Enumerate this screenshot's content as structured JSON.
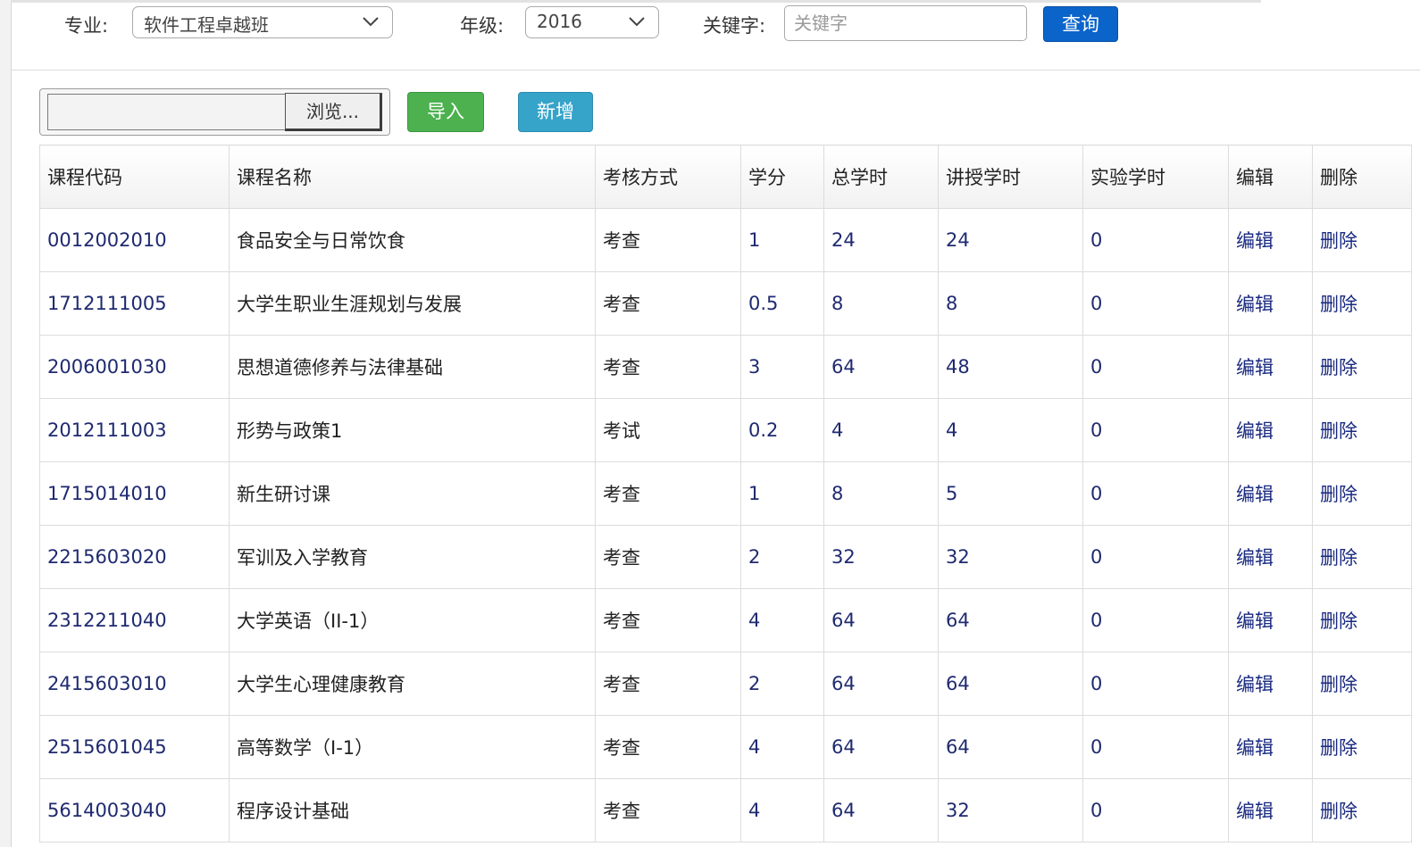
{
  "filters": {
    "major_label": "专业:",
    "major_value": "软件工程卓越班",
    "grade_label": "年级:",
    "grade_value": "2016",
    "keyword_label": "关键字:",
    "keyword_placeholder": "关键字",
    "keyword_value": "",
    "query_label": "查询"
  },
  "toolbar": {
    "browse_label": "浏览...",
    "import_label": "导入",
    "add_label": "新增"
  },
  "table": {
    "columns": [
      "课程代码",
      "课程名称",
      "考核方式",
      "学分",
      "总学时",
      "讲授学时",
      "实验学时",
      "编辑",
      "删除"
    ],
    "rows": [
      {
        "code": "0012002010",
        "name": "食品安全与日常饮食",
        "assess": "考查",
        "credit": "1",
        "total": "24",
        "lecture": "24",
        "lab": "0",
        "edit": "编辑",
        "del": "删除"
      },
      {
        "code": "1712111005",
        "name": "大学生职业生涯规划与发展",
        "assess": "考查",
        "credit": "0.5",
        "total": "8",
        "lecture": "8",
        "lab": "0",
        "edit": "编辑",
        "del": "删除"
      },
      {
        "code": "2006001030",
        "name": "思想道德修养与法律基础",
        "assess": "考查",
        "credit": "3",
        "total": "64",
        "lecture": "48",
        "lab": "0",
        "edit": "编辑",
        "del": "删除"
      },
      {
        "code": "2012111003",
        "name": "形势与政策1",
        "assess": "考试",
        "credit": "0.2",
        "total": "4",
        "lecture": "4",
        "lab": "0",
        "edit": "编辑",
        "del": "删除"
      },
      {
        "code": "1715014010",
        "name": "新生研讨课",
        "assess": "考查",
        "credit": "1",
        "total": "8",
        "lecture": "5",
        "lab": "0",
        "edit": "编辑",
        "del": "删除"
      },
      {
        "code": "2215603020",
        "name": "军训及入学教育",
        "assess": "考查",
        "credit": "2",
        "total": "32",
        "lecture": "32",
        "lab": "0",
        "edit": "编辑",
        "del": "删除"
      },
      {
        "code": "2312211040",
        "name": "大学英语（II-1）",
        "assess": "考查",
        "credit": "4",
        "total": "64",
        "lecture": "64",
        "lab": "0",
        "edit": "编辑",
        "del": "删除"
      },
      {
        "code": "2415603010",
        "name": "大学生心理健康教育",
        "assess": "考查",
        "credit": "2",
        "total": "64",
        "lecture": "64",
        "lab": "0",
        "edit": "编辑",
        "del": "删除"
      },
      {
        "code": "2515601045",
        "name": "高等数学（I-1）",
        "assess": "考查",
        "credit": "4",
        "total": "64",
        "lecture": "64",
        "lab": "0",
        "edit": "编辑",
        "del": "删除"
      },
      {
        "code": "5614003040",
        "name": "程序设计基础",
        "assess": "考查",
        "credit": "4",
        "total": "64",
        "lecture": "32",
        "lab": "0",
        "edit": "编辑",
        "del": "删除"
      }
    ]
  }
}
